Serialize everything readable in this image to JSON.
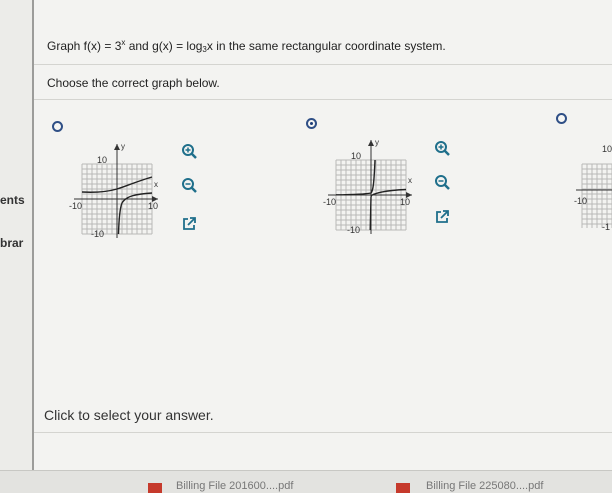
{
  "sidebar": {
    "items": [
      {
        "label": "ents"
      },
      {
        "label": "brar"
      }
    ]
  },
  "question": {
    "prefix": "Graph f(x) = 3",
    "exp": "x",
    "mid": " and g(x) = log",
    "base": "3",
    "suffix": "x  in the same rectangular coordinate system."
  },
  "instruction": "Choose the correct graph below.",
  "options": [
    {
      "selected": false,
      "labels": {
        "y": "y",
        "x": "x",
        "ymax": "10",
        "ymin": "-10",
        "xmin": "-10",
        "xmax": "10"
      }
    },
    {
      "selected": true,
      "labels": {
        "y": "y",
        "x": "x",
        "ymax": "10",
        "ymin": "-10",
        "xmin": "-10",
        "xmax": "10"
      }
    },
    {
      "selected": false,
      "labels": {
        "ymax": "10",
        "xmin": "-10",
        "yminpart": "-1"
      }
    }
  ],
  "tools": {
    "zoom_in": "zoom-in-icon",
    "zoom_out": "zoom-out-icon",
    "expand": "external-link-icon"
  },
  "footer": {
    "prompt": "Click to select your answer."
  },
  "taskbar": {
    "items": [
      {
        "label": "Billing File 201600....pdf"
      },
      {
        "label": "Billing File 225080....pdf"
      }
    ]
  },
  "colors": {
    "radio": "#2f4f86",
    "curve": "#222222",
    "grid": "#b8b8b8",
    "tool_icon": "#1f6f8b"
  }
}
